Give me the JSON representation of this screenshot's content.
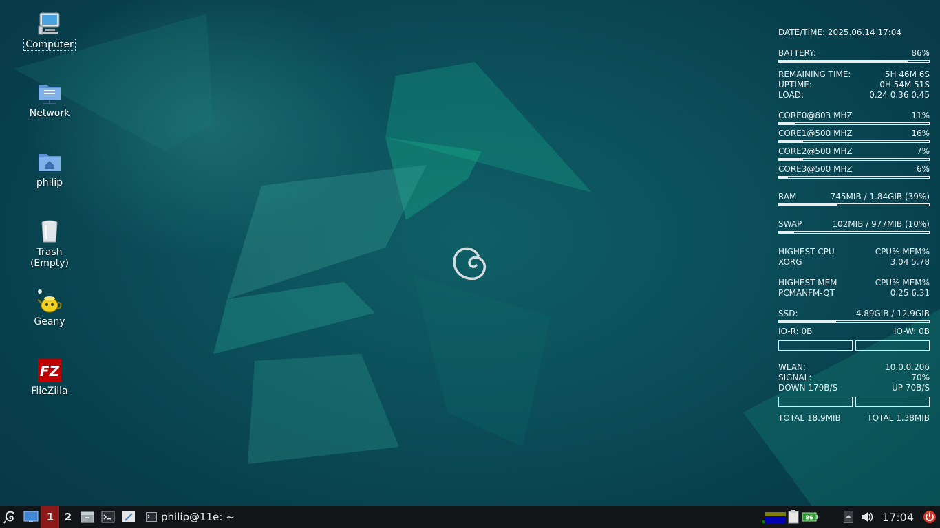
{
  "desktop": {
    "icons": [
      {
        "label": "Computer",
        "icon": "computer-icon"
      },
      {
        "label": "Network",
        "icon": "network-folder-icon"
      },
      {
        "label": "philip",
        "icon": "home-folder-icon"
      },
      {
        "label": "Trash (Empty)",
        "icon": "trash-icon"
      },
      {
        "label": "Geany",
        "icon": "geany-icon"
      },
      {
        "label": "FileZilla",
        "icon": "filezilla-icon"
      }
    ]
  },
  "conky": {
    "datetime": {
      "label": "DATE/TIME: 2025.06.14 17:04"
    },
    "battery": {
      "label": "BATTERY:",
      "value": "86%",
      "level": 0.86
    },
    "remaining": {
      "label": "REMAINING TIME:",
      "value": "5H 46M 6S"
    },
    "uptime": {
      "label": "UPTIME:",
      "value": "0H 54M 51S"
    },
    "load": {
      "label": "LOAD:",
      "value": "0.24 0.36 0.45"
    },
    "cores": [
      {
        "label": "CORE0@803 MHZ",
        "value": "11%",
        "level": 0.11
      },
      {
        "label": "CORE1@500 MHZ",
        "value": "16%",
        "level": 0.16
      },
      {
        "label": "CORE2@500 MHZ",
        "value": "7%",
        "level": 0.16
      },
      {
        "label": "CORE3@500 MHZ",
        "value": "6%",
        "level": 0.06
      }
    ],
    "ram": {
      "label": "RAM",
      "value": "745MIB / 1.84GIB (39%)",
      "level": 0.39
    },
    "swap": {
      "label": "SWAP",
      "value": "102MIB / 977MIB (10%)",
      "level": 0.1
    },
    "highest_cpu": {
      "label": "HIGHEST CPU",
      "cols": "CPU% MEM%",
      "proc": "XORG",
      "vals": "3.04  5.78"
    },
    "highest_mem": {
      "label": "HIGHEST MEM",
      "cols": "CPU% MEM%",
      "proc": "PCMANFM-QT",
      "vals": "0.25  6.31"
    },
    "ssd": {
      "label": "SSD:",
      "value": "4.89GIB / 12.9GIB",
      "level": 0.38
    },
    "io": {
      "read": "IO-R: 0B",
      "write": "IO-W: 0B"
    },
    "wlan": {
      "label": "WLAN:",
      "value": "10.0.0.206"
    },
    "signal": {
      "label": "SIGNAL:",
      "value": "70%"
    },
    "down": "DOWN 179B/S",
    "up": "UP 70B/S",
    "total_down": "TOTAL 18.9MIB",
    "total_up": "TOTAL 1.38MIB"
  },
  "taskbar": {
    "workspaces": [
      "1",
      "2"
    ],
    "task_label": "philip@11e: ~",
    "battery_tray": "86",
    "clock": "17:04"
  }
}
